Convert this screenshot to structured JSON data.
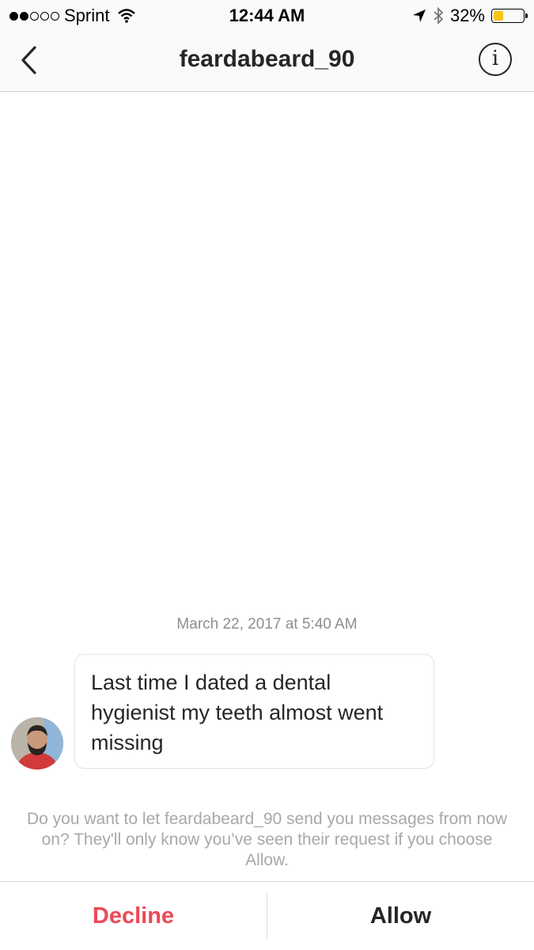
{
  "status_bar": {
    "carrier": "Sprint",
    "time": "12:44 AM",
    "battery_percent": "32%",
    "battery_level": 0.32,
    "icons": [
      "signal-dots-icon",
      "wifi-icon",
      "location-arrow-icon",
      "bluetooth-icon",
      "battery-icon"
    ]
  },
  "nav": {
    "title": "feardabeard_90",
    "back_icon": "chevron-left-icon",
    "info_label": "i"
  },
  "thread": {
    "timestamp": "March 22, 2017 at 5:40 AM",
    "messages": [
      {
        "text": "Last time I dated a dental hygienist my teeth almost went missing"
      }
    ]
  },
  "request": {
    "prompt": "Do you want to let feardabeard_90 send you messages from now on? They'll only know you’ve seen their request if you choose Allow.",
    "decline_label": "Decline",
    "allow_label": "Allow"
  },
  "colors": {
    "decline": "#ed4956",
    "battery": "#f5c518"
  }
}
